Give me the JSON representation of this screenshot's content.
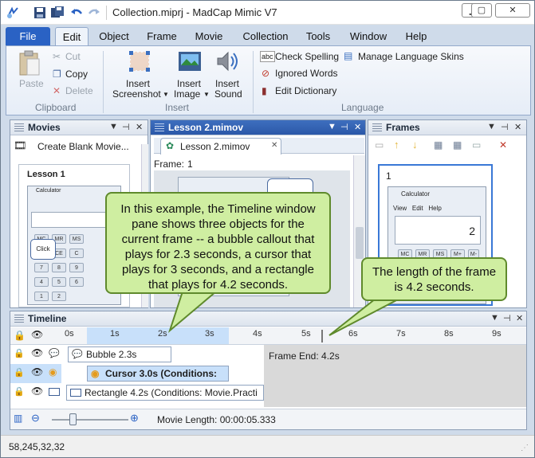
{
  "window": {
    "title": "Collection.miprj - MadCap Mimic V7"
  },
  "menu": {
    "tabs": [
      "File",
      "Edit",
      "Object",
      "Frame",
      "Movie",
      "Collection",
      "Tools",
      "Window",
      "Help"
    ]
  },
  "ribbon": {
    "clipboard": {
      "paste": "Paste",
      "cut": "Cut",
      "copy": "Copy",
      "delete": "Delete",
      "group": "Clipboard"
    },
    "insert": {
      "screenshot_1": "Insert",
      "screenshot_2": "Screenshot",
      "image_1": "Insert",
      "image_2": "Image",
      "sound_1": "Insert",
      "sound_2": "Sound",
      "group": "Insert"
    },
    "language": {
      "check_spelling": "Check Spelling",
      "ignored_words": "Ignored Words",
      "edit_dictionary": "Edit Dictionary",
      "manage_skins": "Manage Language Skins",
      "group": "Language"
    }
  },
  "movies_pane": {
    "title": "Movies",
    "create_blank": "Create Blank Movie...",
    "thumb_label": "Lesson 1",
    "calc_title": "Calculator",
    "click_label": "Click"
  },
  "lesson_pane": {
    "title": "Lesson 2.mimov",
    "doc_tab": "Lesson 2.mimov",
    "frame_label": "Frame:",
    "frame_value": "1"
  },
  "frames_pane": {
    "title": "Frames",
    "frame_number": "1",
    "calc_title": "Calculator",
    "calc_menu": "View   Edit   Help",
    "calc_display": "2"
  },
  "callouts": {
    "main": "In this example, the Timeline window pane shows three objects for the current frame -- a bubble callout that plays for 2.3 seconds, a cursor that plays for 3 seconds, and a rectangle that plays for 4.2 seconds.",
    "frame": "The length of the frame is 4.2 seconds."
  },
  "timeline": {
    "title": "Timeline",
    "ticks": [
      "0s",
      "1s",
      "2s",
      "3s",
      "4s",
      "5s",
      "6s",
      "7s",
      "8s",
      "9s"
    ],
    "frame_end": "Frame End: 4.2s",
    "rows": [
      {
        "label": "Bubble 2.3s",
        "duration_s": 2.3
      },
      {
        "label": "Cursor 3.0s (Conditions:",
        "duration_s": 3.0
      },
      {
        "label": "Rectangle 4.2s (Conditions: Movie.Practi",
        "duration_s": 4.2
      }
    ],
    "movie_length": "Movie Length: 00:00:05.333"
  },
  "status": {
    "text": "58,245,32,32"
  },
  "colors": {
    "accent": "#2a62c4",
    "callout_fill": "#cfeea1",
    "callout_border": "#5f8a2c",
    "timeline_highlight": "#c8e0fa"
  }
}
